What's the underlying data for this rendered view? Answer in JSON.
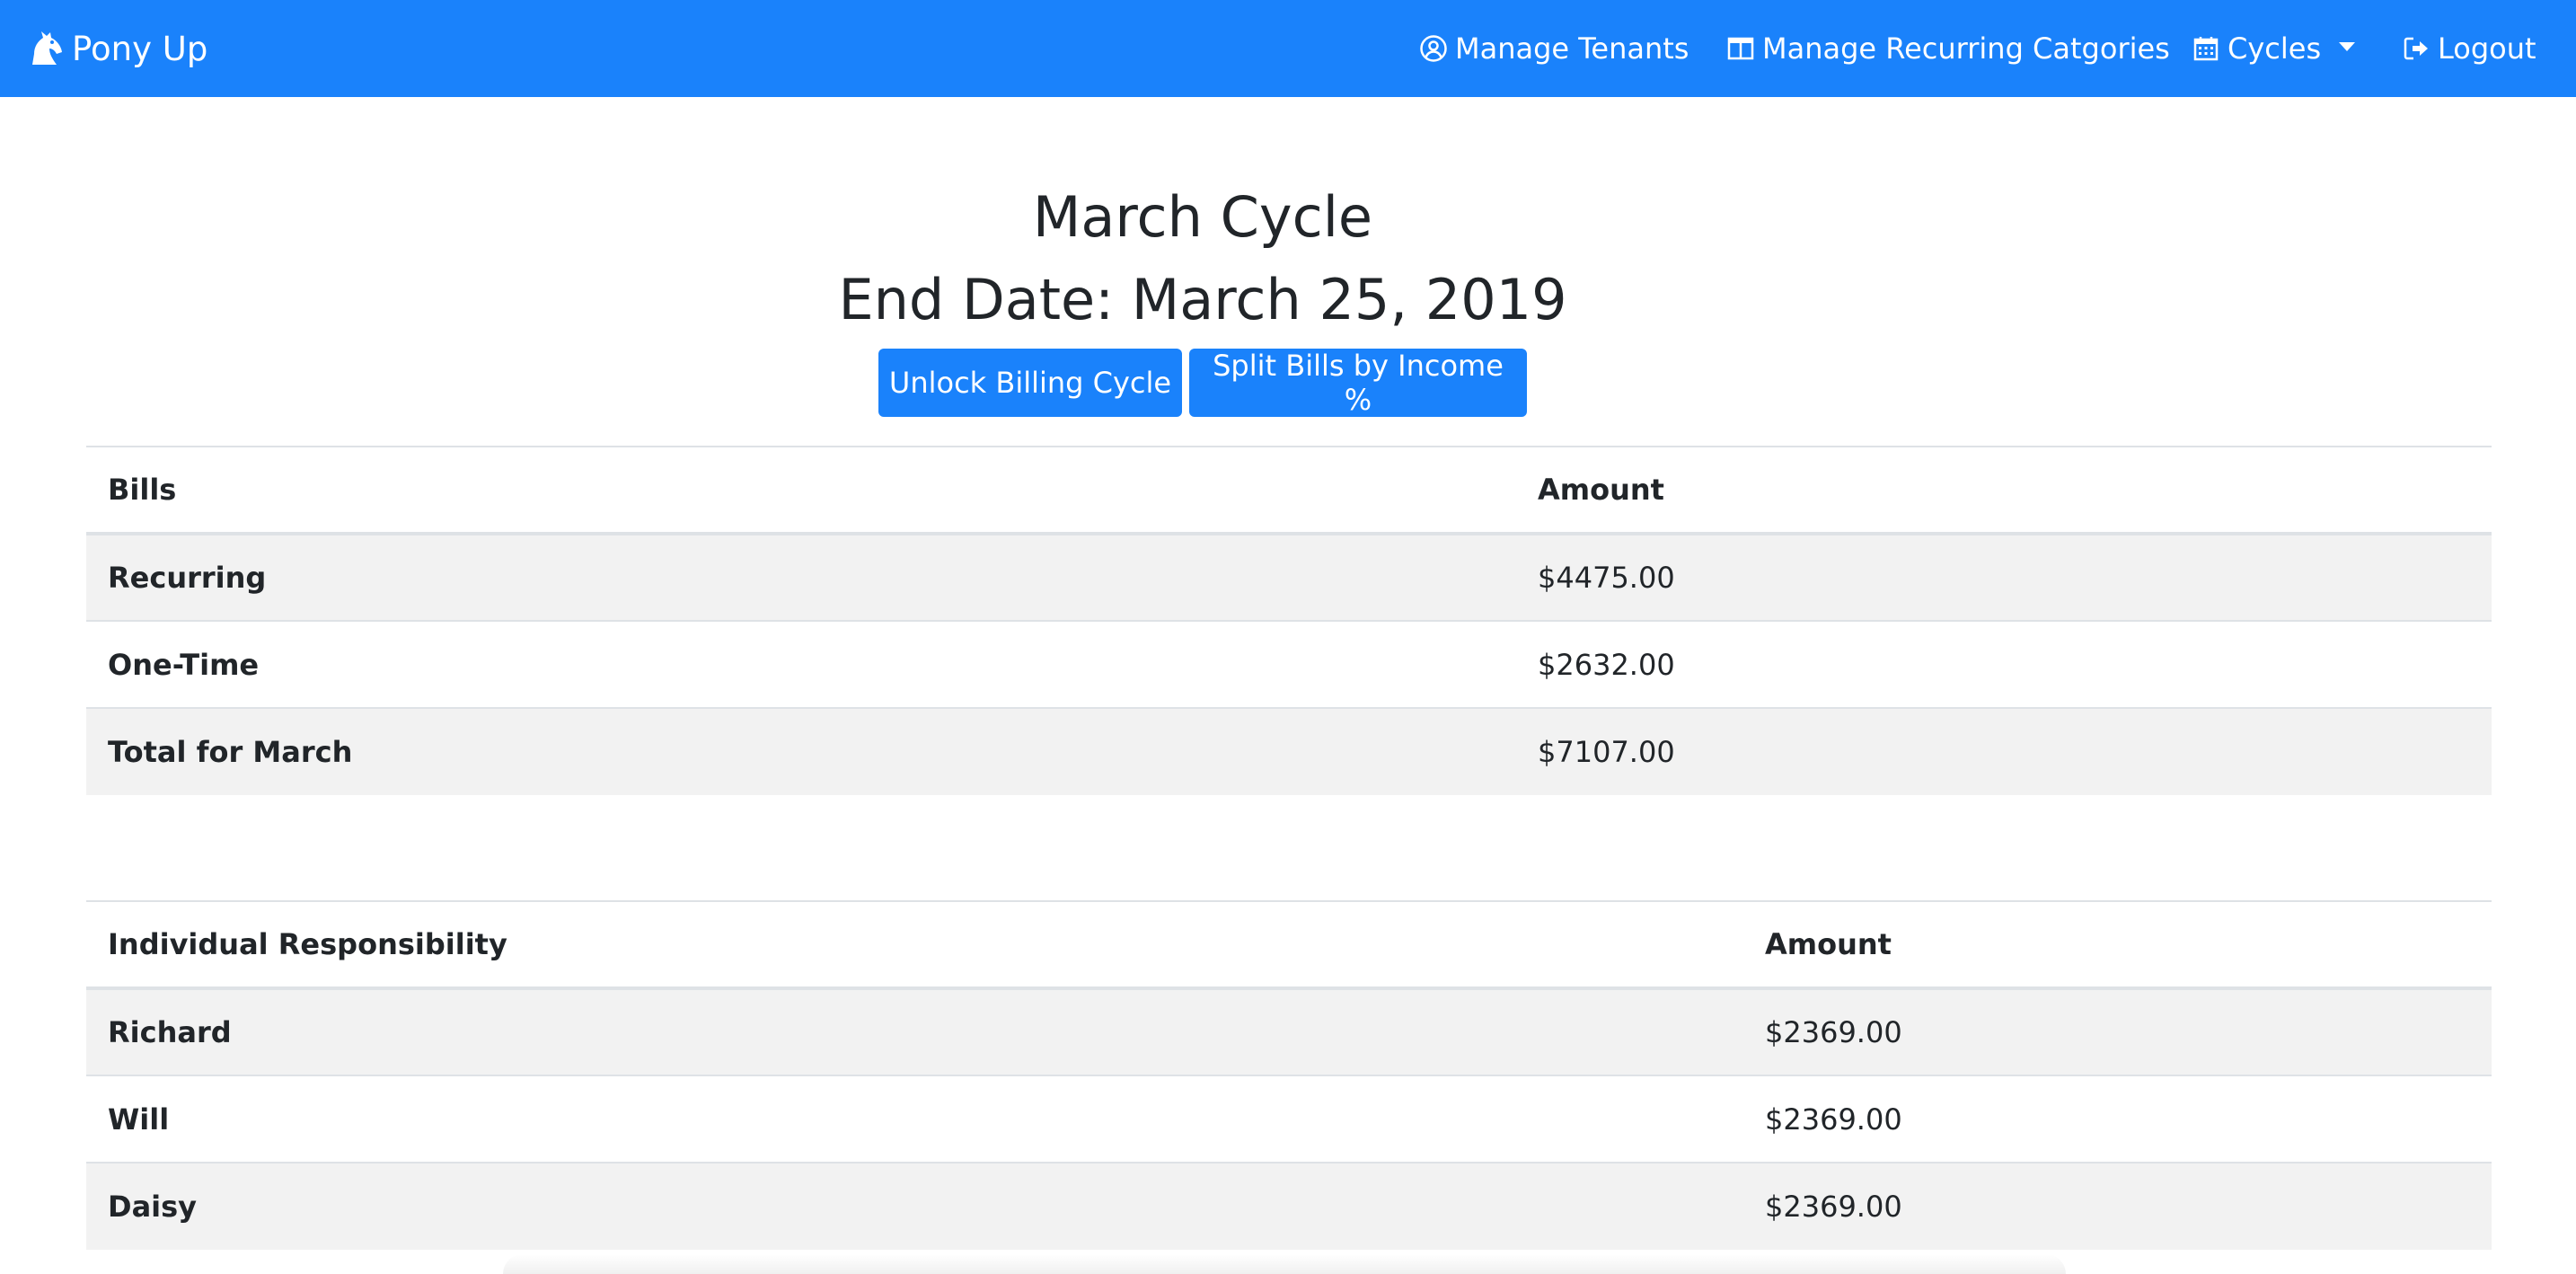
{
  "navbar": {
    "brand": "Pony Up",
    "brand_icon": "horse-head-icon",
    "background": "#1a82fb",
    "items": [
      {
        "label": "Manage Tenants",
        "icon": "user-circle-icon"
      },
      {
        "label": "Manage Recurring Catgories",
        "icon": "columns-icon"
      },
      {
        "label": "Cycles",
        "icon": "calendar-icon"
      },
      {
        "label": "Logout",
        "icon": "sign-out-icon"
      }
    ]
  },
  "header": {
    "title": "March Cycle",
    "end_date": "End Date: March 25, 2019"
  },
  "buttons": {
    "unlock": "Unlock Billing Cycle",
    "split": "Split Bills by Income %"
  },
  "bills_table": {
    "headers": [
      "Bills",
      "Amount"
    ],
    "rows": [
      {
        "label": "Recurring",
        "amount": "$4475.00"
      },
      {
        "label": "One-Time",
        "amount": "$2632.00"
      },
      {
        "label": "Total for March",
        "amount": "$7107.00"
      }
    ]
  },
  "responsibility_table": {
    "headers": [
      "Individual Responsibility",
      "Amount"
    ],
    "rows": [
      {
        "label": "Richard",
        "amount": "$2369.00"
      },
      {
        "label": "Will",
        "amount": "$2369.00"
      },
      {
        "label": "Daisy",
        "amount": "$2369.00"
      }
    ]
  }
}
